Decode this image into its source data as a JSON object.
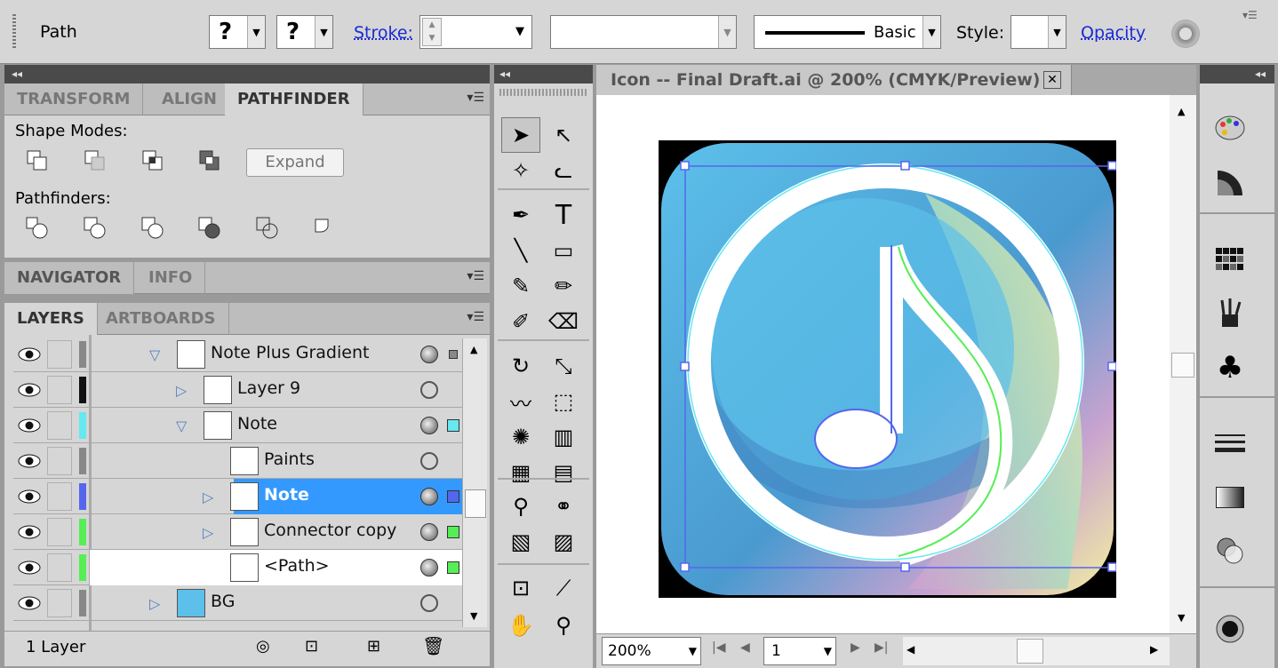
{
  "control_bar": {
    "selection_type": "Path",
    "fill_swatch": "?",
    "stroke_swatch": "?",
    "stroke_label": "Stroke:",
    "profile": "Basic",
    "style_label": "Style:",
    "opacity_label": "Opacity"
  },
  "pathfinder_panel": {
    "tabs": [
      "TRANSFORM",
      "ALIGN",
      "PATHFINDER"
    ],
    "active_tab": "PATHFINDER",
    "shape_modes_label": "Shape Modes:",
    "expand_label": "Expand",
    "pathfinders_label": "Pathfinders:"
  },
  "navigator_panel": {
    "tabs": [
      "NAVIGATOR",
      "INFO"
    ]
  },
  "layers_panel": {
    "tabs": [
      "LAYERS",
      "ARTBOARDS"
    ],
    "rows": [
      {
        "name": "Note Plus Gradient",
        "color": "#888888",
        "expanded": true,
        "has_toggle": true,
        "indent": 0
      },
      {
        "name": "Layer 9",
        "color": "#111111",
        "expanded": false,
        "has_toggle": true,
        "indent": 1
      },
      {
        "name": "Note",
        "color": "#66e8f0",
        "expanded": true,
        "has_toggle": true,
        "indent": 1
      },
      {
        "name": "Paints",
        "color": "#888888",
        "expanded": false,
        "has_toggle": false,
        "indent": 2
      },
      {
        "name": "Note",
        "color": "#5566ee",
        "expanded": false,
        "has_toggle": true,
        "indent": 2
      },
      {
        "name": "Connector copy",
        "color": "#55ee55",
        "expanded": false,
        "has_toggle": true,
        "indent": 2
      },
      {
        "name": "<Path>",
        "color": "#55ee55",
        "expanded": false,
        "has_toggle": false,
        "indent": 2
      },
      {
        "name": "BG",
        "color": "#888888",
        "expanded": false,
        "has_toggle": true,
        "indent": 0
      }
    ],
    "layer_count": "1 Layer"
  },
  "document": {
    "title": "Icon -- Final Draft.ai @ 200% (CMYK/Preview)",
    "zoom": "200%",
    "artboard_number": "1"
  },
  "colors": {
    "selection_blue": "#5566ee",
    "accent_blue": "#3399ff",
    "icon_bg": "#58b9e6"
  },
  "tools": [
    "selection-tool",
    "direct-selection-tool",
    "magic-wand-tool",
    "lasso-tool",
    "pen-tool",
    "type-tool",
    "line-tool",
    "rectangle-tool",
    "paintbrush-tool",
    "pencil-tool",
    "blob-brush-tool",
    "eraser-tool",
    "rotate-tool",
    "scale-tool",
    "warp-tool",
    "free-transform-tool",
    "symbol-sprayer-tool",
    "graph-tool",
    "mesh-tool",
    "gradient-tool",
    "eyedropper-tool",
    "blend-tool",
    "live-paint-bucket-tool",
    "live-paint-selection-tool",
    "artboard-tool",
    "slice-tool",
    "hand-tool",
    "zoom-tool"
  ],
  "dock": [
    "color-palette-icon",
    "gradient-icon",
    "swatches-icon",
    "brushes-icon",
    "symbols-icon",
    "stroke-icon",
    "gradient-panel-icon",
    "transparency-icon",
    "appearance-icon"
  ]
}
